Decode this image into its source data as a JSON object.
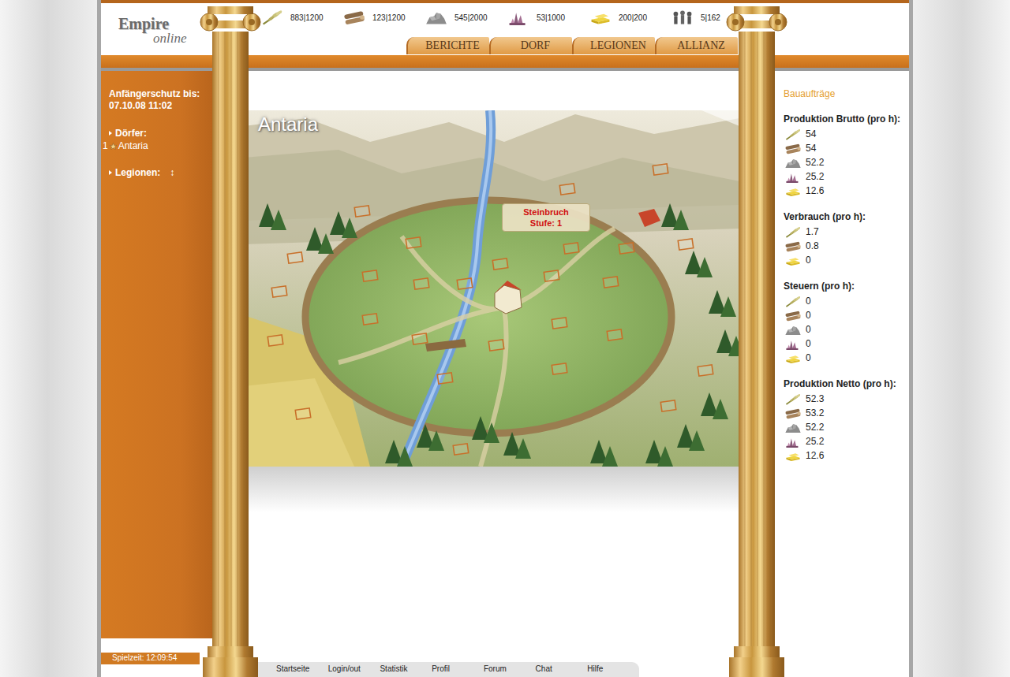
{
  "logo": {
    "line1": "Empire",
    "line2": "online"
  },
  "resources": [
    {
      "kind": "grain",
      "text": "883|1200"
    },
    {
      "kind": "wood",
      "text": "123|1200"
    },
    {
      "kind": "stone",
      "text": "545|2000"
    },
    {
      "kind": "ore",
      "text": "53|1000"
    },
    {
      "kind": "gold",
      "text": "200|200"
    },
    {
      "kind": "people",
      "text": "5|162"
    }
  ],
  "nav": [
    {
      "label": "BERICHTE"
    },
    {
      "label": "DORF"
    },
    {
      "label": "LEGIONEN"
    },
    {
      "label": "ALLIANZ"
    }
  ],
  "sidebar": {
    "protection_label": "Anfängerschutz bis:",
    "protection_date": "07.10.08 11:02",
    "villages_label": "Dörfer:",
    "villages": [
      {
        "number": "1",
        "name": "Antaria"
      }
    ],
    "legions_label": "Legionen:",
    "legions_toggle": "↕",
    "playtime": "Spielzeit: 12:09:54"
  },
  "village": {
    "title": "Antaria",
    "tooltip": {
      "building": "Steinbruch",
      "level": "Stufe: 1"
    }
  },
  "right": {
    "orders": "Bauaufträge",
    "sections": [
      {
        "title": "Produktion Brutto (pro h):",
        "items": [
          {
            "kind": "grain",
            "value": "54"
          },
          {
            "kind": "wood",
            "value": "54"
          },
          {
            "kind": "stone",
            "value": "52.2"
          },
          {
            "kind": "ore",
            "value": "25.2"
          },
          {
            "kind": "gold",
            "value": "12.6"
          }
        ]
      },
      {
        "title": "Verbrauch (pro h):",
        "items": [
          {
            "kind": "grain",
            "value": "1.7"
          },
          {
            "kind": "wood",
            "value": "0.8"
          },
          {
            "kind": "gold",
            "value": "0"
          }
        ]
      },
      {
        "title": "Steuern (pro h):",
        "items": [
          {
            "kind": "grain",
            "value": "0"
          },
          {
            "kind": "wood",
            "value": "0"
          },
          {
            "kind": "stone",
            "value": "0"
          },
          {
            "kind": "ore",
            "value": "0"
          },
          {
            "kind": "gold",
            "value": "0"
          }
        ]
      },
      {
        "title": "Produktion Netto (pro h):",
        "items": [
          {
            "kind": "grain",
            "value": "52.3"
          },
          {
            "kind": "wood",
            "value": "53.2"
          },
          {
            "kind": "stone",
            "value": "52.2"
          },
          {
            "kind": "ore",
            "value": "25.2"
          },
          {
            "kind": "gold",
            "value": "12.6"
          }
        ]
      }
    ]
  },
  "footer": [
    {
      "label": "Startseite"
    },
    {
      "label": "Login/out"
    },
    {
      "label": "Statistik"
    },
    {
      "label": "Profil"
    },
    {
      "label": "Forum"
    },
    {
      "label": "Chat"
    },
    {
      "label": "Hilfe"
    }
  ]
}
